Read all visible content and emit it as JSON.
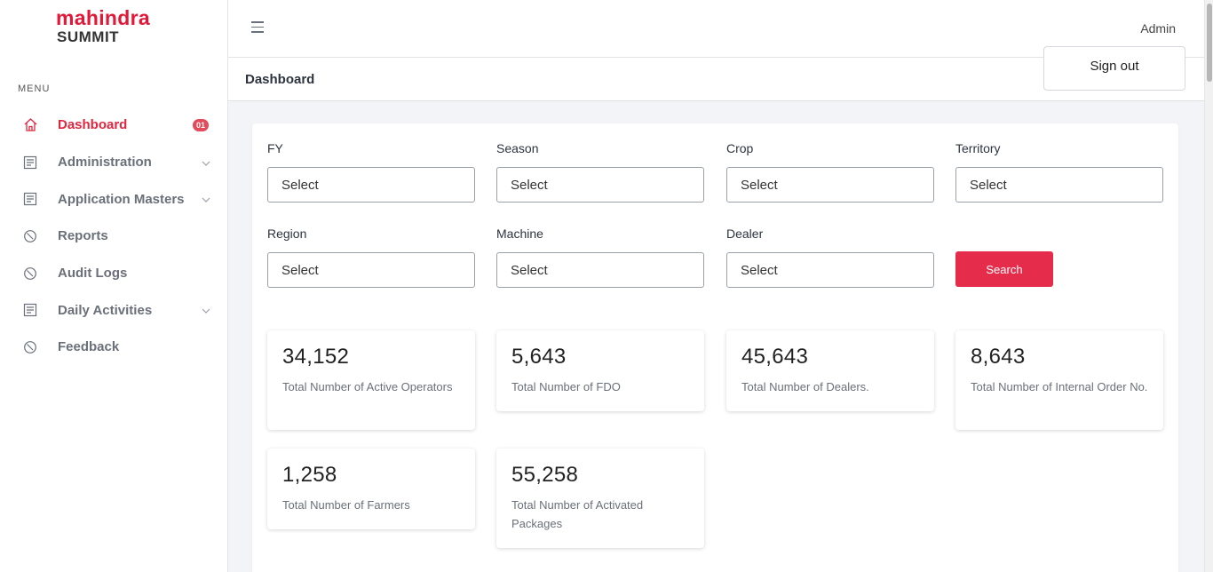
{
  "brand": {
    "top": "mahindra",
    "bottom": "SUMMIT"
  },
  "sidebar": {
    "heading": "MENU",
    "items": [
      {
        "label": "Dashboard",
        "icon": "home-icon",
        "badge": "01",
        "active": true
      },
      {
        "label": "Administration",
        "icon": "document-icon",
        "expandable": true
      },
      {
        "label": "Application Masters",
        "icon": "document-icon",
        "expandable": true
      },
      {
        "label": "Reports",
        "icon": "clock-icon"
      },
      {
        "label": "Audit Logs",
        "icon": "clock-icon"
      },
      {
        "label": "Daily Activities",
        "icon": "document-icon",
        "expandable": true
      },
      {
        "label": "Feedback",
        "icon": "clock-icon"
      }
    ]
  },
  "header": {
    "user": "Admin",
    "signout_label": "Sign out",
    "page_title": "Dashboard"
  },
  "filters": {
    "fy": {
      "label": "FY",
      "value": "Select"
    },
    "season": {
      "label": "Season",
      "value": "Select"
    },
    "crop": {
      "label": "Crop",
      "value": "Select"
    },
    "territory": {
      "label": "Territory",
      "value": "Select"
    },
    "region": {
      "label": "Region",
      "value": "Select"
    },
    "machine": {
      "label": "Machine",
      "value": "Select"
    },
    "dealer": {
      "label": "Dealer",
      "value": "Select"
    },
    "search_label": "Search"
  },
  "stats": [
    {
      "value": "34,152",
      "label": "Total Number of Active Operators"
    },
    {
      "value": "5,643",
      "label": "Total Number of FDO"
    },
    {
      "value": "45,643",
      "label": "Total Number of Dealers."
    },
    {
      "value": "8,643",
      "label": "Total Number of Internal Order No."
    },
    {
      "value": "1,258",
      "label": "Total Number of Farmers"
    },
    {
      "value": "55,258",
      "label": "Total Number of Activated Packages"
    }
  ],
  "colors": {
    "accent": "#e52d4b",
    "brand_red": "#e31837",
    "text_muted": "#6a7079"
  }
}
